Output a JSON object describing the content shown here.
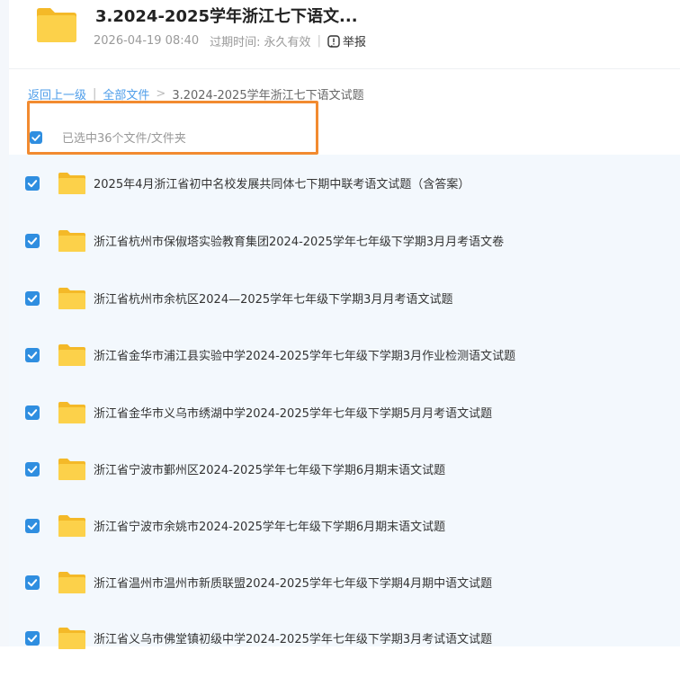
{
  "header": {
    "title": "3.2024-2025学年浙江七下语文...",
    "date": "2026-04-19 08:40",
    "expire_label": "过期时间:",
    "expire_value": "永久有效",
    "report_label": "举报"
  },
  "breadcrumb": {
    "back": "返回上一级",
    "all_files": "全部文件",
    "current": "3.2024-2025学年浙江七下语文试题"
  },
  "selection": {
    "text": "已选中36个文件/文件夹",
    "highlight_color": "#f28b30"
  },
  "colors": {
    "checkbox": "#2f8ee0",
    "folder": "#fcc93e",
    "link": "#4e9de9"
  },
  "files": [
    {
      "name": "2025年4月浙江省初中名校发展共同体七下期中联考语文试题（含答案）",
      "checked": true
    },
    {
      "name": "浙江省杭州市保俶塔实验教育集团2024-2025学年七年级下学期3月月考语文卷",
      "checked": true
    },
    {
      "name": "浙江省杭州市余杭区2024—2025学年七年级下学期3月月考语文试题",
      "checked": true
    },
    {
      "name": "浙江省金华市浦江县实验中学2024-2025学年七年级下学期3月作业检测语文试题",
      "checked": true
    },
    {
      "name": "浙江省金华市义乌市绣湖中学2024-2025学年七年级下学期5月月考语文试题",
      "checked": true
    },
    {
      "name": "浙江省宁波市鄞州区2024-2025学年七年级下学期6月期末语文试题",
      "checked": true
    },
    {
      "name": "浙江省宁波市余姚市2024-2025学年七年级下学期6月期末语文试题",
      "checked": true
    },
    {
      "name": "浙江省温州市温州市新质联盟2024-2025学年七年级下学期4月期中语文试题",
      "checked": true
    },
    {
      "name": "浙江省义乌市佛堂镇初级中学2024-2025学年七年级下学期3月考试语文试题",
      "checked": true
    }
  ]
}
